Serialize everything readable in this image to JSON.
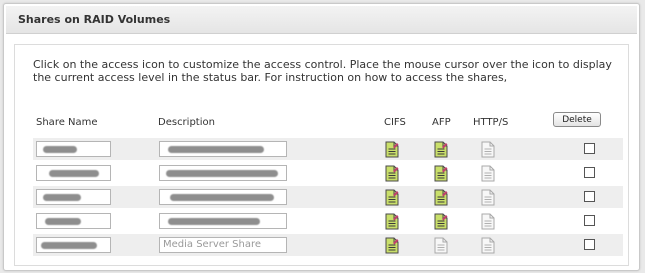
{
  "panel": {
    "title": "Shares on RAID Volumes"
  },
  "instructions": "Click on the access icon to customize the access control. Place the mouse cursor over the icon to display the current access level in the status bar. For instruction on how to access the shares,",
  "columns": {
    "share_name": "Share Name",
    "description": "Description",
    "cifs": "CIFS",
    "afp": "AFP",
    "https": "HTTP/S"
  },
  "delete_label": "Delete",
  "rows": [
    {
      "description": "",
      "cifs": "enabled",
      "afp": "enabled",
      "https": "disabled",
      "delete_checked": false
    },
    {
      "description": "",
      "cifs": "enabled",
      "afp": "enabled",
      "https": "disabled",
      "delete_checked": false
    },
    {
      "description": "",
      "cifs": "enabled",
      "afp": "enabled",
      "https": "disabled",
      "delete_checked": false
    },
    {
      "description": "",
      "cifs": "enabled",
      "afp": "enabled",
      "https": "disabled",
      "delete_checked": false
    },
    {
      "description": "Media Server Share",
      "cifs": "enabled",
      "afp": "disabled",
      "https": "disabled",
      "delete_checked": false
    }
  ],
  "colors": {
    "enabled_icon_fill": "#c9df6a",
    "enabled_icon_mark": "#c0406e",
    "disabled_icon_fill": "#f7f7f7"
  }
}
